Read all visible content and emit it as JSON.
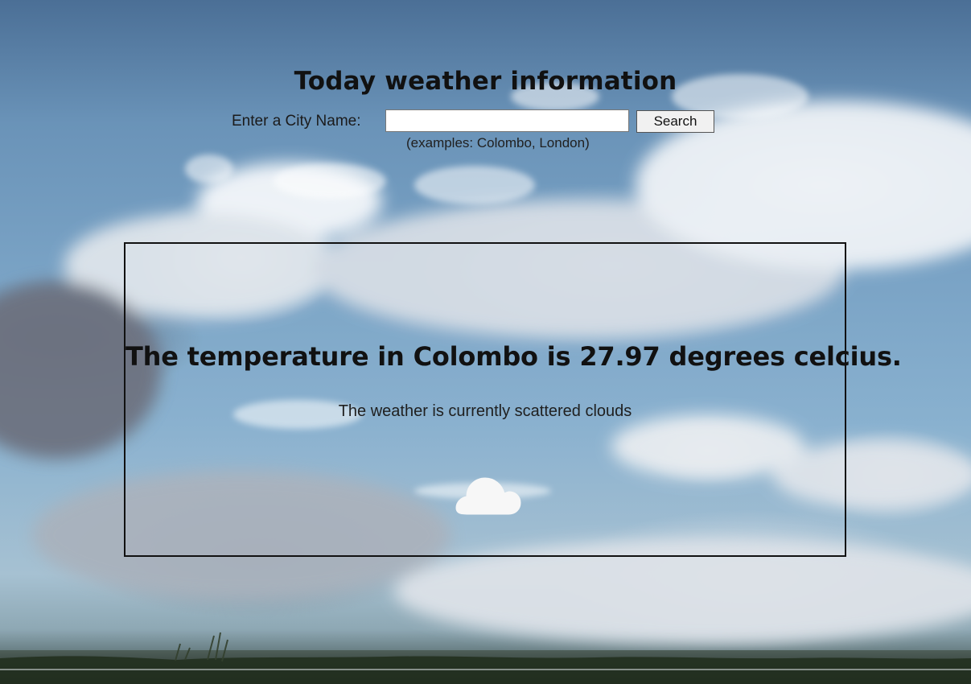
{
  "colors": {
    "text_primary": "#111111",
    "panel_border": "#111111",
    "button_bg": "#f1f1f1",
    "cloud_icon": "#f7f7f7"
  },
  "header": {
    "title": "Today weather information"
  },
  "search": {
    "label": "Enter a City Name:",
    "value": "",
    "placeholder": "",
    "button_label": "Search",
    "examples": "(examples: Colombo, London)"
  },
  "result": {
    "temperature_text": "The temperature in Colombo is 27.97 degrees celcius.",
    "weather_text": "The weather is currently scattered clouds",
    "icon_name": "cloud-icon"
  }
}
